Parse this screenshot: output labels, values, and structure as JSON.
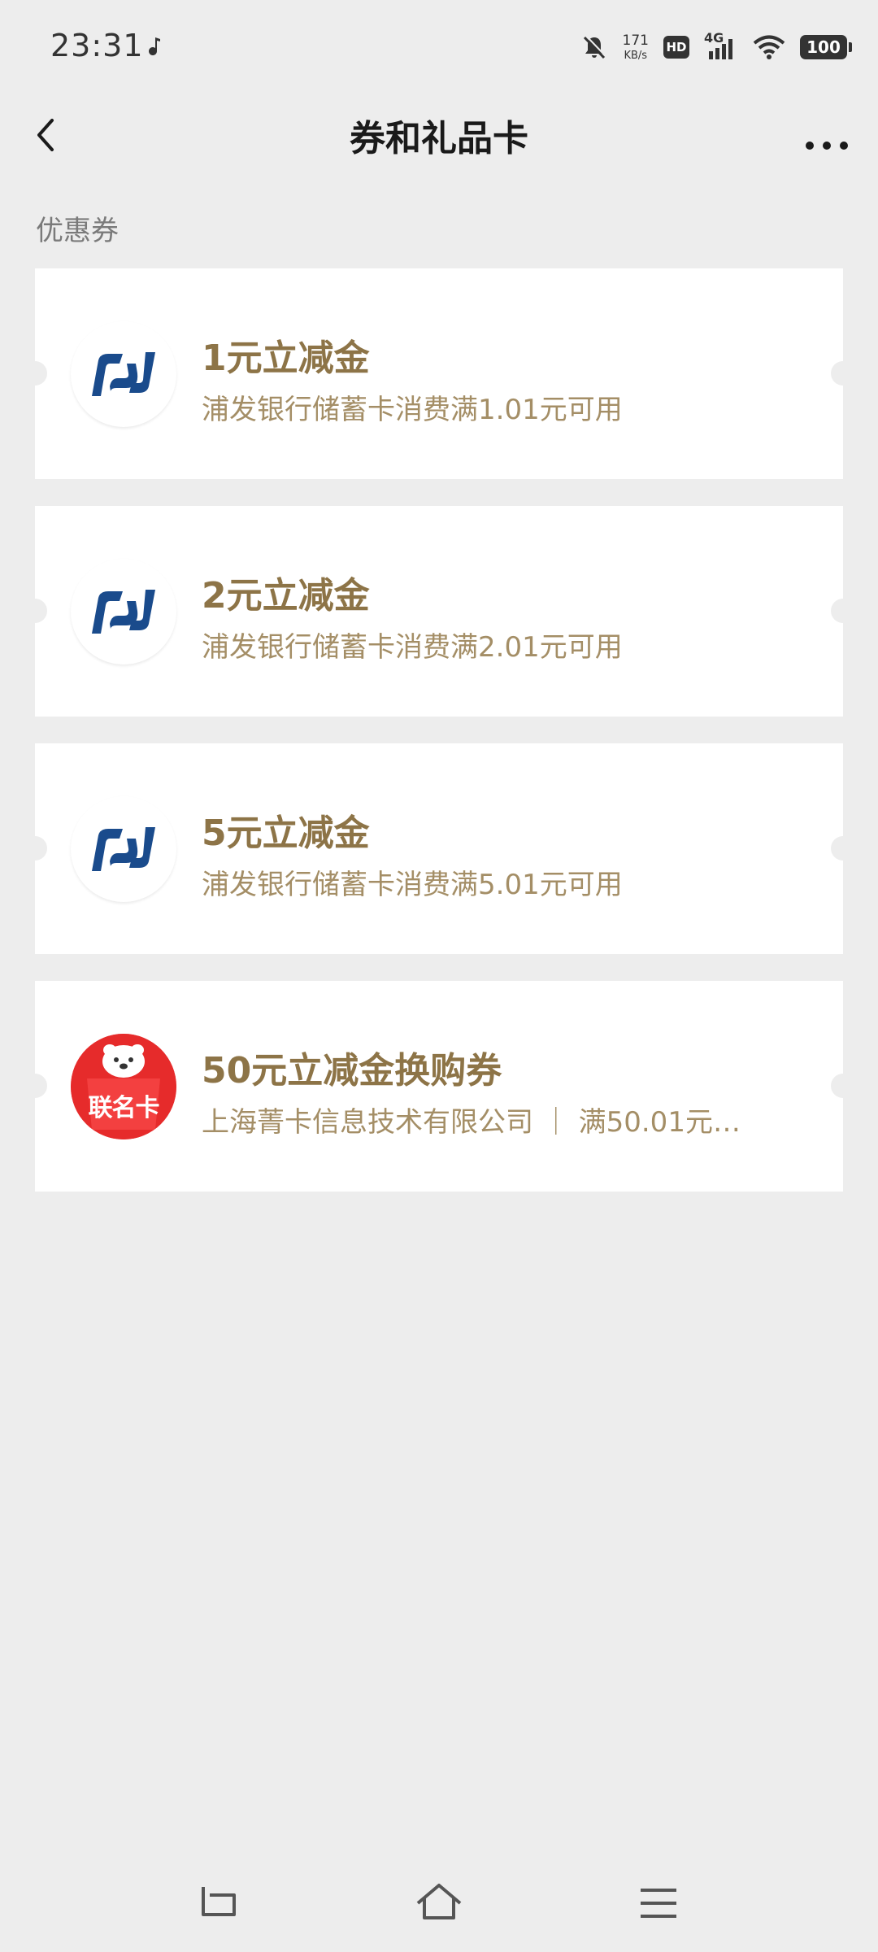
{
  "status_bar": {
    "time": "23:31",
    "net_speed_value": "171",
    "net_speed_unit": "KB/s",
    "hd_label": "HD",
    "network_label": "4G",
    "battery_level": "100"
  },
  "nav": {
    "title": "券和礼品卡"
  },
  "section": {
    "label": "优惠券"
  },
  "coupons": [
    {
      "title": "1元立减金",
      "desc": "浦发银行储蓄卡消费满1.01元可用",
      "logo": "spdb-logo-icon"
    },
    {
      "title": "2元立减金",
      "desc": "浦发银行储蓄卡消费满2.01元可用",
      "logo": "spdb-logo-icon"
    },
    {
      "title": "5元立减金",
      "desc": "浦发银行储蓄卡消费满5.01元可用",
      "logo": "spdb-logo-icon"
    },
    {
      "title": "50元立减金换购券",
      "desc": "上海菁卡信息技术有限公司 ｜ 满50.01元…",
      "logo": "lianmingka-logo-icon",
      "logo_text": "联名卡"
    }
  ],
  "colors": {
    "background": "#ededed",
    "coupon_title": "#8d7447",
    "coupon_desc": "#a48e66",
    "spdb_blue": "#1a4b8c",
    "lianming_red": "#e62b2b"
  }
}
